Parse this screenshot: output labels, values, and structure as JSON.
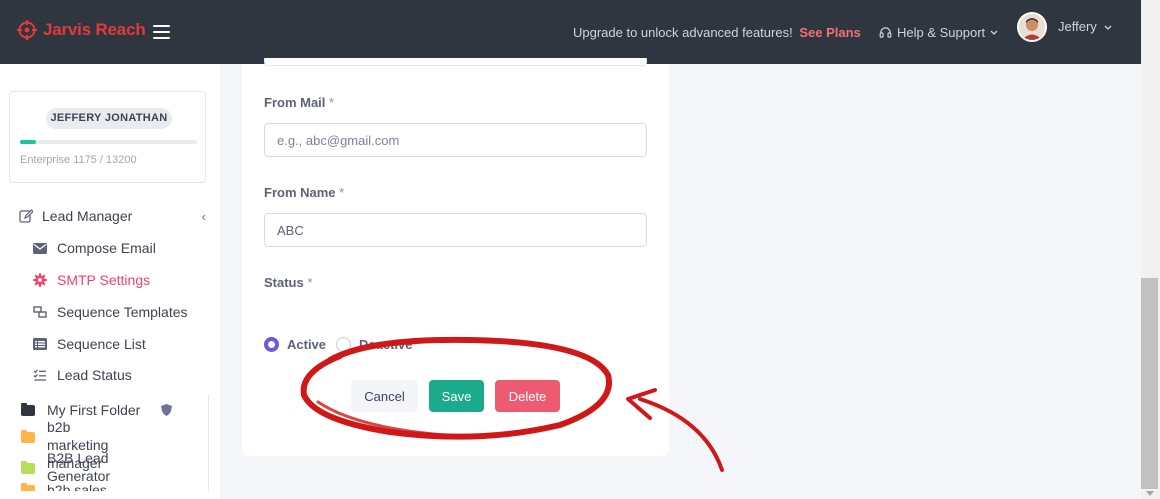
{
  "header": {
    "brand": "Jarvis Reach",
    "upgrade_text": "Upgrade to unlock advanced features!",
    "see_plans": "See Plans",
    "help_label": "Help & Support",
    "user_name": "Jeffery",
    "colors": {
      "bar": "#2f3640",
      "brand": "#e23a3a",
      "accent": "#f1707a"
    }
  },
  "sidebar": {
    "profile_name": "JEFFERY JONATHAN",
    "plan_text": "Enterprise 1175 / 13200",
    "plan_used_fraction": 0.089,
    "section_label": "Lead Manager",
    "items": [
      {
        "label": "Compose Email",
        "icon": "envelope-icon"
      },
      {
        "label": "SMTP Settings",
        "icon": "gear-icon"
      },
      {
        "label": "Sequence Templates",
        "icon": "sequence-icon"
      },
      {
        "label": "Sequence List",
        "icon": "list-icon"
      },
      {
        "label": "Lead Status",
        "icon": "checklist-icon"
      }
    ],
    "folders": [
      {
        "label": "My First Folder",
        "color": "#2f3640"
      },
      {
        "label": "b2b marketing manager",
        "color": "#ffb547"
      },
      {
        "label": "B2B Lead Generator",
        "color": "#b5e05a"
      },
      {
        "label": "b2b sales",
        "color": "#ffb547"
      }
    ]
  },
  "form": {
    "from_mail_label": "From Mail",
    "from_mail_placeholder": "e.g., abc@gmail.com",
    "from_name_label": "From Name",
    "from_name_value": "ABC",
    "required_mark": "*",
    "status_label": "Status",
    "status_options": [
      "Active",
      "Deactive"
    ],
    "status_selected": "Active",
    "cancel_label": "Cancel",
    "save_label": "Save",
    "delete_label": "Delete"
  }
}
